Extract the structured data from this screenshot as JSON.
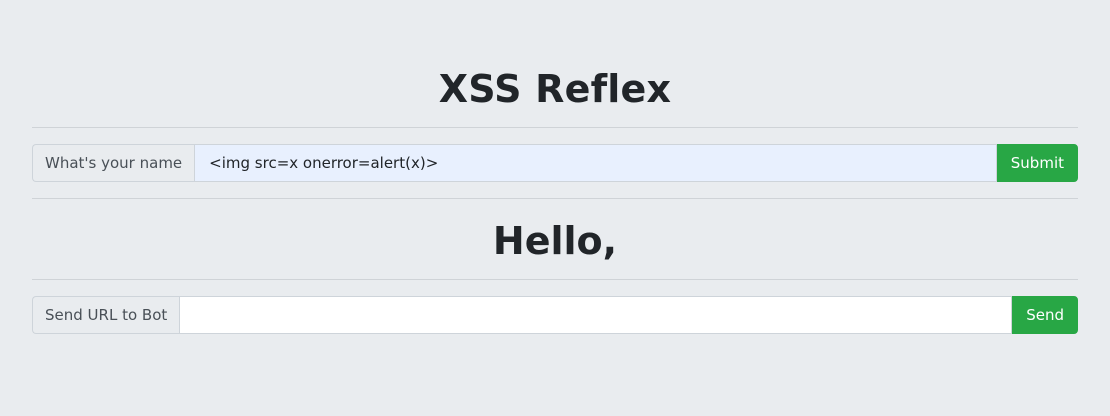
{
  "page": {
    "title": "XSS Reflex",
    "greeting": "Hello,"
  },
  "name_form": {
    "label": "What's your name",
    "value": "<img src=x onerror=alert(x)>",
    "button_label": "Submit"
  },
  "bot_form": {
    "label": "Send URL to Bot",
    "value": "",
    "button_label": "Send"
  },
  "colors": {
    "background": "#e9ecef",
    "button": "#28a745",
    "autofill_input": "#e8f0fe"
  }
}
